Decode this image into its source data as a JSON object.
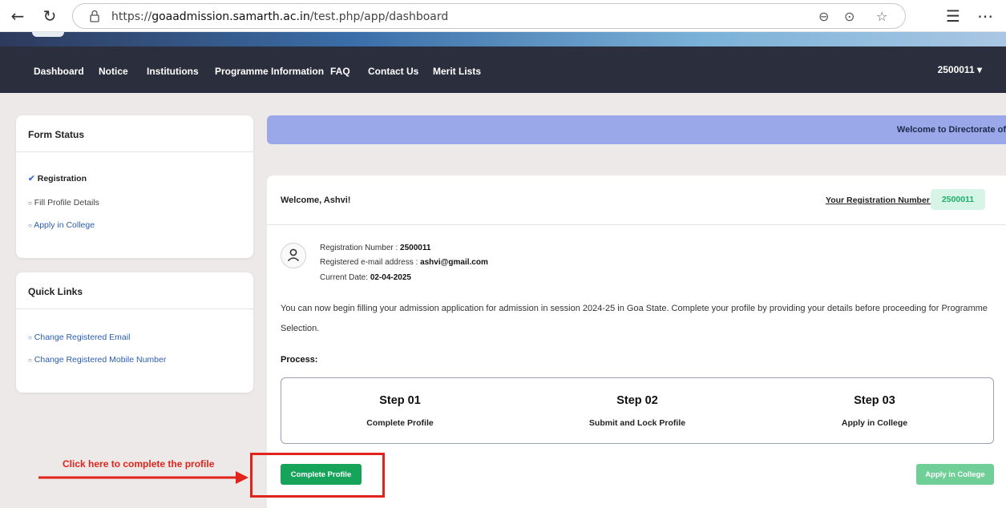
{
  "browser": {
    "url_prefix": "https://",
    "url_host": "goaadmission.samarth.ac.in",
    "url_path": "/test.php/app/dashboard",
    "icons": [
      "back-icon",
      "refresh-icon",
      "lock-icon",
      "zoom-icon",
      "reader-icon",
      "favorite-icon",
      "favorites-list-icon",
      "more-icon"
    ]
  },
  "navbar": {
    "items": [
      "Dashboard",
      "Notice",
      "Institutions",
      "Programme Information",
      "FAQ",
      "Contact Us",
      "Merit Lists"
    ],
    "user": "2500011",
    "user_caret": "▾"
  },
  "form_status": {
    "title": "Form Status",
    "items": [
      {
        "label": "Registration",
        "marker": "✔",
        "state": "done"
      },
      {
        "label": "Fill Profile Details",
        "marker": "○",
        "state": "pending"
      },
      {
        "label": "Apply in College",
        "marker": "○",
        "state": "link"
      }
    ]
  },
  "quick_links": {
    "title": "Quick Links",
    "items": [
      {
        "label": "Change Registered Email",
        "marker": "○"
      },
      {
        "label": "Change Registered Mobile Number",
        "marker": "○"
      }
    ]
  },
  "banner": {
    "text": "Welcome to Directorate of"
  },
  "main": {
    "welcome": "Welcome, Ashvi!",
    "reg_label": "Your Registration Number is",
    "reg_colon": ":",
    "reg_number": "2500011",
    "info": {
      "reg_label": "Registration Number :",
      "reg_value": "2500011",
      "email_label": "Registered e-mail address :",
      "email_value": "ashvi@gmail.com",
      "date_label": "Current Date:",
      "date_value": "02-04-2025"
    },
    "paragraph": "You can now begin filling your admission application for admission in session 2024-25 in Goa State. Complete your profile by providing your details before proceeding for Programme Selection.",
    "process_label": "Process:",
    "steps": [
      {
        "title": "Step 01",
        "sub": "Complete Profile"
      },
      {
        "title": "Step 02",
        "sub": "Submit and Lock Profile"
      },
      {
        "title": "Step 03",
        "sub": "Apply in College"
      }
    ],
    "complete_button": "Complete Profile",
    "apply_button": "Apply in College"
  },
  "annotation": {
    "text": "Click here to complete the profile"
  },
  "colors": {
    "navbar_bg": "#2b2e3c",
    "banner_bg": "#9aa8ea",
    "primary_green": "#16a35a",
    "light_green": "#6fcf97",
    "annotation_red": "#e0231b",
    "link_blue": "#2a5db0"
  }
}
